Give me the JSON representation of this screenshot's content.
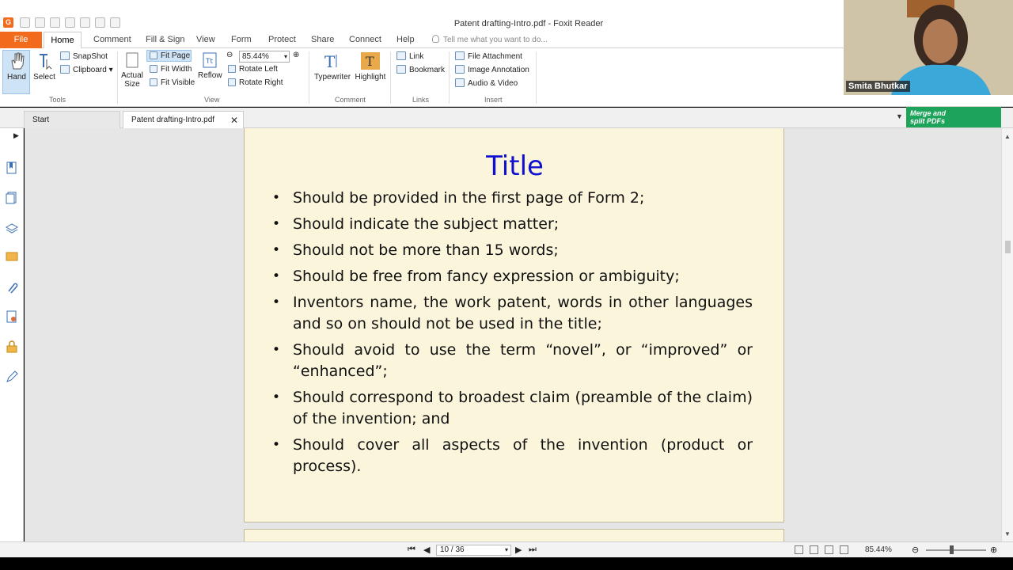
{
  "window": {
    "title": "Patent drafting-Intro.pdf - Foxit Reader"
  },
  "menu": {
    "file": "File",
    "items": [
      "Home",
      "Comment",
      "Fill & Sign",
      "View",
      "Form",
      "Protect",
      "Share",
      "Connect",
      "Help"
    ],
    "tell_me": "Tell me what you want to do..."
  },
  "ribbon": {
    "tools": {
      "hand": "Hand",
      "select": "Select",
      "snapshot": "SnapShot",
      "clipboard": "Clipboard",
      "label": "Tools"
    },
    "view": {
      "actual_size_1": "Actual",
      "actual_size_2": "Size",
      "fit_page": "Fit Page",
      "fit_width": "Fit Width",
      "fit_visible": "Fit Visible",
      "reflow": "Reflow",
      "zoom": "85.44%",
      "rotate_left": "Rotate Left",
      "rotate_right": "Rotate Right",
      "label": "View"
    },
    "comment": {
      "typewriter": "Typewriter",
      "highlight": "Highlight",
      "label": "Comment"
    },
    "links": {
      "link": "Link",
      "bookmark": "Bookmark",
      "label": "Links"
    },
    "insert": {
      "file_attachment": "File Attachment",
      "image_annotation": "Image Annotation",
      "audio_video": "Audio & Video",
      "label": "Insert"
    }
  },
  "tabs": {
    "start": "Start",
    "active": "Patent drafting-Intro.pdf"
  },
  "banner": {
    "line1": "Merge and",
    "line2": "split PDFs"
  },
  "slide": {
    "title": "Title",
    "bullets": [
      "Should be provided in the first page of Form 2;",
      "Should indicate the subject matter;",
      "Should not be more than 15 words;",
      "Should be free from fancy expression or ambiguity;",
      "Inventors name, the work patent, words in other languages and so on should not be used in the title;",
      "Should avoid to use the term “novel”, or “improved” or “enhanced”;",
      "Should correspond to broadest claim (preamble of the claim) of the invention; and",
      "Should cover all aspects of the invention (product or process)."
    ]
  },
  "status": {
    "page": "10 / 36",
    "zoom": "85.44%"
  },
  "webcam": {
    "name": "Smita Bhutkar"
  },
  "colors": {
    "accent": "#f26b1d",
    "slide_title": "#1010d0",
    "slide_bg": "#fbf5dc",
    "banner": "#1ea45a"
  }
}
